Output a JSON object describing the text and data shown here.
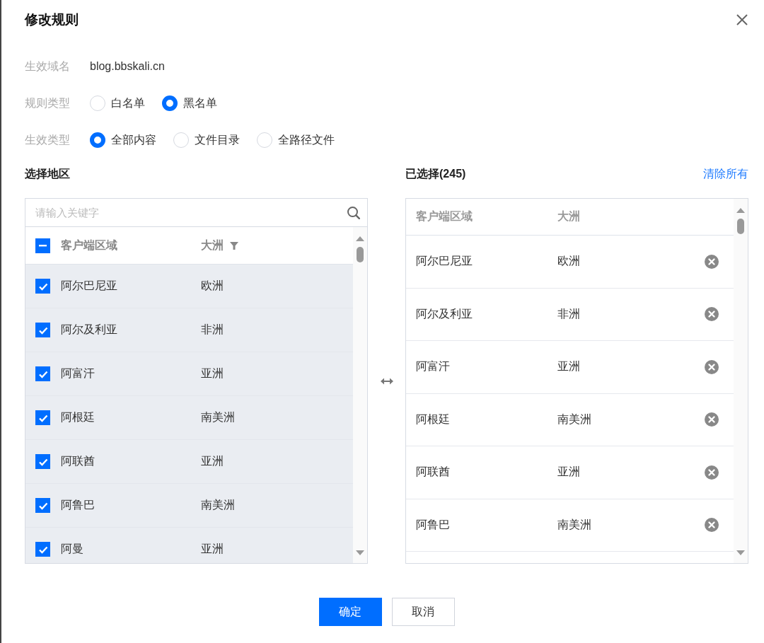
{
  "dialog": {
    "title": "修改规则"
  },
  "fields": [
    {
      "label": "生效域名",
      "kind": "text",
      "value": "blog.bbskali.cn"
    },
    {
      "label": "规则类型",
      "kind": "radio",
      "options": [
        {
          "label": "白名单",
          "selected": false
        },
        {
          "label": "黑名单",
          "selected": true
        }
      ]
    },
    {
      "label": "生效类型",
      "kind": "radio",
      "options": [
        {
          "label": "全部内容",
          "selected": true
        },
        {
          "label": "文件目录",
          "selected": false
        },
        {
          "label": "全路径文件",
          "selected": false
        }
      ]
    }
  ],
  "source": {
    "title": "选择地区",
    "search": {
      "placeholder": "请输入关键字"
    },
    "header_checkbox": {
      "indeterminate": true
    },
    "columns": [
      "客户端区域",
      "大洲"
    ],
    "rows": [
      {
        "region": "阿尔巴尼亚",
        "continent": "欧洲",
        "checked": true
      },
      {
        "region": "阿尔及利亚",
        "continent": "非洲",
        "checked": true
      },
      {
        "region": "阿富汗",
        "continent": "亚洲",
        "checked": true
      },
      {
        "region": "阿根廷",
        "continent": "南美洲",
        "checked": true
      },
      {
        "region": "阿联酋",
        "continent": "亚洲",
        "checked": true
      },
      {
        "region": "阿鲁巴",
        "continent": "南美洲",
        "checked": true
      },
      {
        "region": "阿曼",
        "continent": "亚洲",
        "checked": true
      }
    ]
  },
  "target": {
    "title": "已选择(245)",
    "clear_link": "清除所有",
    "columns": [
      "客户端区域",
      "大洲"
    ],
    "rows": [
      {
        "region": "阿尔巴尼亚",
        "continent": "欧洲"
      },
      {
        "region": "阿尔及利亚",
        "continent": "非洲"
      },
      {
        "region": "阿富汗",
        "continent": "亚洲"
      },
      {
        "region": "阿根廷",
        "continent": "南美洲"
      },
      {
        "region": "阿联酋",
        "continent": "亚洲"
      },
      {
        "region": "阿鲁巴",
        "continent": "南美洲"
      }
    ]
  },
  "buttons": [
    {
      "label": "确定",
      "kind": "primary"
    },
    {
      "label": "取消",
      "kind": "default"
    }
  ]
}
